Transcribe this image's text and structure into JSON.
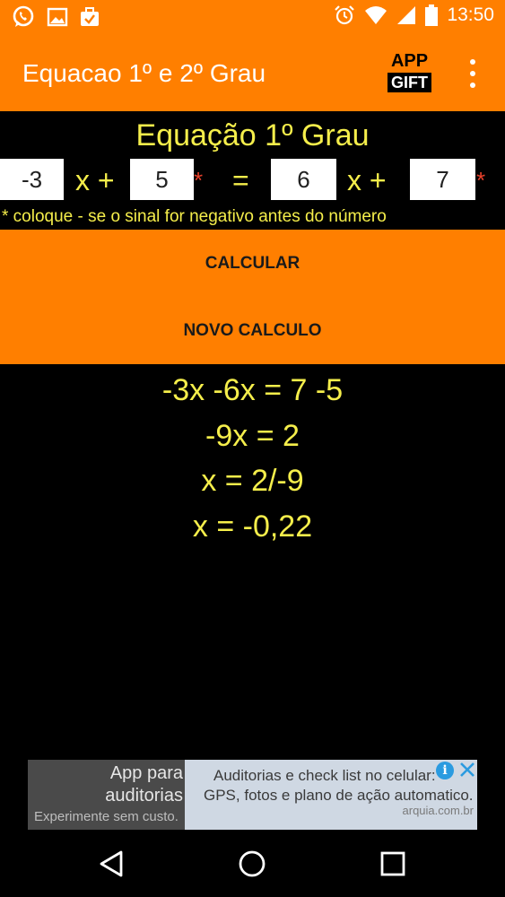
{
  "status_bar": {
    "time": "13:50",
    "left_icons": [
      "whatsapp-icon",
      "gallery-icon",
      "briefcase-check-icon"
    ],
    "right_icons": [
      "alarm-icon",
      "wifi-icon",
      "signal-icon",
      "battery-icon"
    ]
  },
  "app_bar": {
    "title": "Equacao 1º e 2º Grau",
    "gift_top": "APP",
    "gift_bottom": "GIFT",
    "menu_icon": "overflow-menu-icon"
  },
  "equation": {
    "title": "Equação 1º Grau",
    "a_value": "-3",
    "b_value": "5",
    "c_value": "6",
    "d_value": "7",
    "x_plus_label": "x +",
    "equals_label": "=",
    "required_mark": "*",
    "hint": "* coloque - se o sinal for negativo antes do número"
  },
  "buttons": {
    "calculate": "CALCULAR",
    "new_calc": "NOVO CALCULO"
  },
  "results": {
    "lines": [
      "-3x -6x = 7 -5",
      "-9x = 2",
      "x = 2/-9",
      "x = -0,22"
    ]
  },
  "ad": {
    "left_line1": "App para",
    "left_line2": "auditorias",
    "left_line3": "Experimente sem custo.",
    "right_line1": "Auditorias e check list no celular:",
    "right_line2": "GPS, fotos e plano de ação automatico.",
    "right_url": "arquia.com.br",
    "info_glyph": "i"
  },
  "colors": {
    "accent_orange": "#ff7f00",
    "text_yellow": "#f5ee4b",
    "required_red": "#e8412b",
    "background": "#000000"
  }
}
